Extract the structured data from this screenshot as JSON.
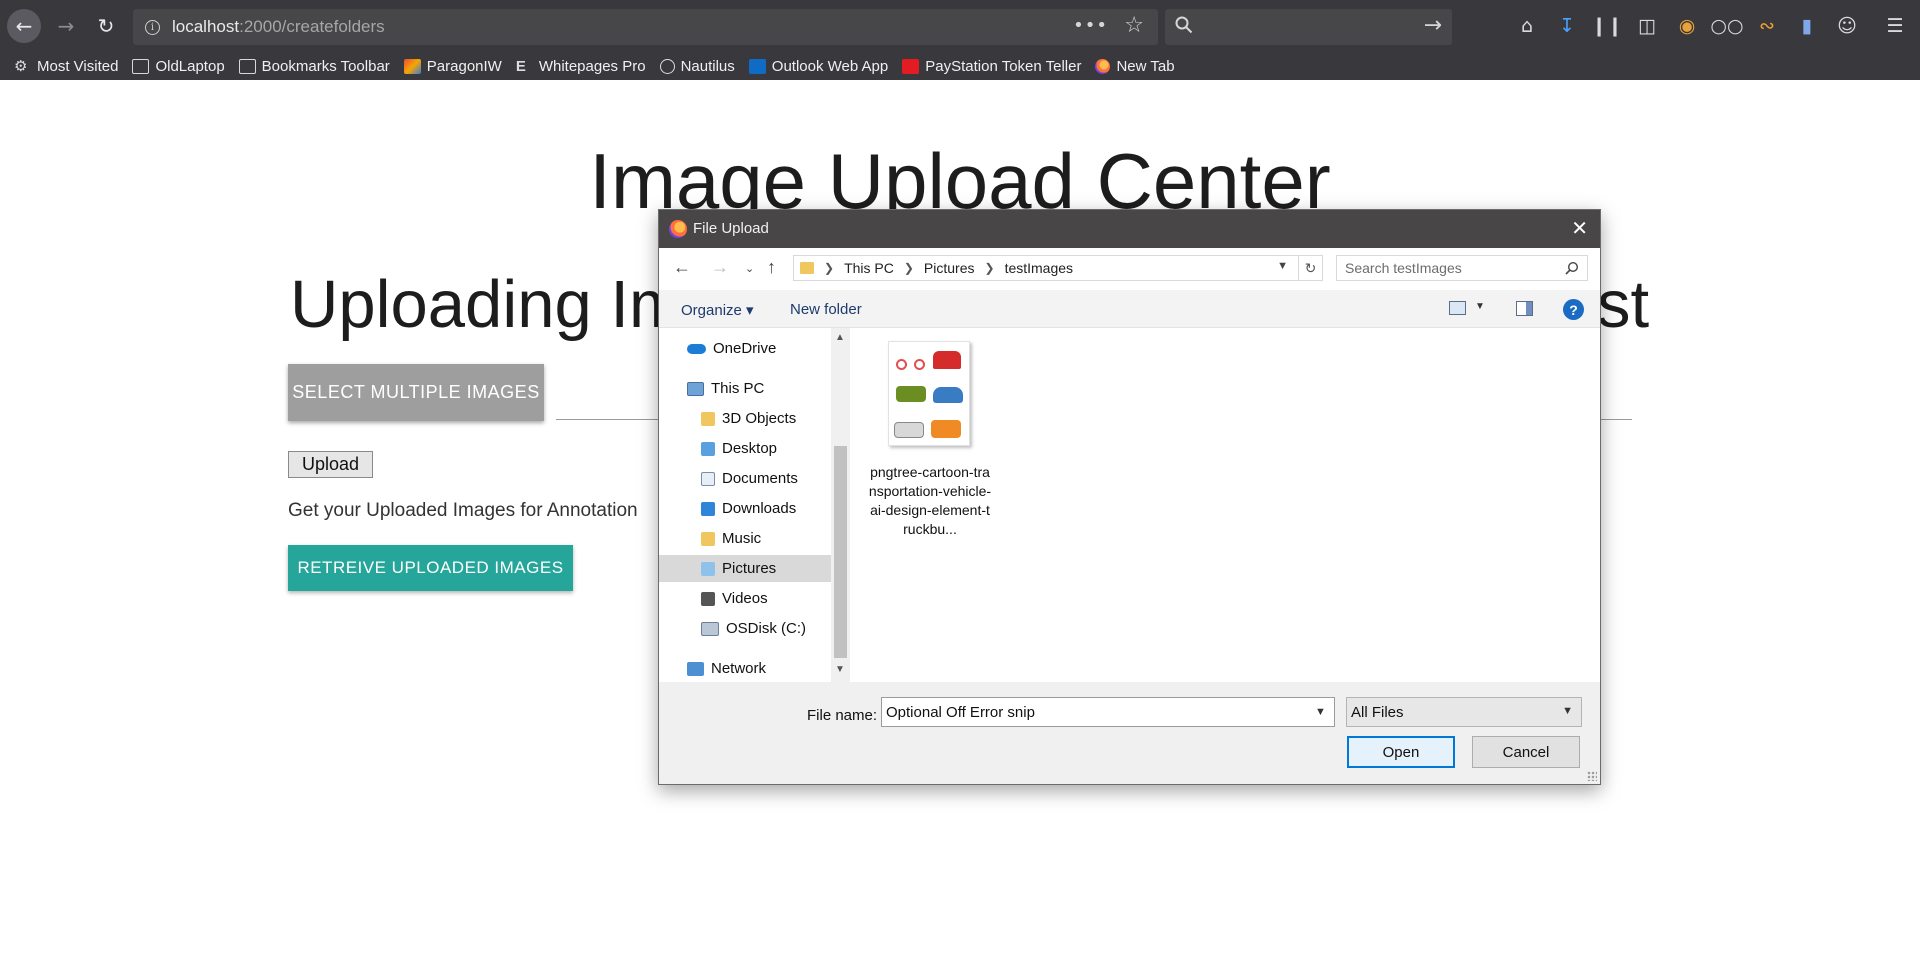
{
  "browser": {
    "url_host": "localhost",
    "url_path": ":2000/createfolders",
    "bookmarks": [
      {
        "label": "Most Visited"
      },
      {
        "label": "OldLaptop"
      },
      {
        "label": "Bookmarks Toolbar"
      },
      {
        "label": "ParagonIW"
      },
      {
        "label": "Whitepages Pro"
      },
      {
        "label": "Nautilus"
      },
      {
        "label": "Outlook Web App"
      },
      {
        "label": "PayStation Token Teller"
      },
      {
        "label": "New Tab"
      }
    ]
  },
  "page": {
    "title": "Image Upload Center",
    "subtitle_start": "Uploading Im",
    "subtitle_end": "st",
    "select_button": "SELECT MULTIPLE IMAGES",
    "upload_button": "Upload",
    "annotation_text": "Get your Uploaded Images for Annotation",
    "retrieve_button": "RETREIVE UPLOADED IMAGES"
  },
  "dialog": {
    "title": "File Upload",
    "breadcrumbs": [
      "This PC",
      "Pictures",
      "testImages"
    ],
    "search_placeholder": "Search testImages",
    "toolbar": {
      "organize": "Organize",
      "new_folder": "New folder"
    },
    "nav_items": [
      {
        "label": "OneDrive"
      },
      {
        "label": "This PC"
      },
      {
        "label": "3D Objects"
      },
      {
        "label": "Desktop"
      },
      {
        "label": "Documents"
      },
      {
        "label": "Downloads"
      },
      {
        "label": "Music"
      },
      {
        "label": "Pictures"
      },
      {
        "label": "Videos"
      },
      {
        "label": "OSDisk (C:)"
      },
      {
        "label": "Network"
      }
    ],
    "file": {
      "name": "pngtree-cartoon-transportation-vehicle-ai-design-element-truckbu..."
    },
    "file_name_label": "File name:",
    "file_name_value": "Optional Off Error snip",
    "file_type": "All Files",
    "open_button": "Open",
    "cancel_button": "Cancel"
  }
}
